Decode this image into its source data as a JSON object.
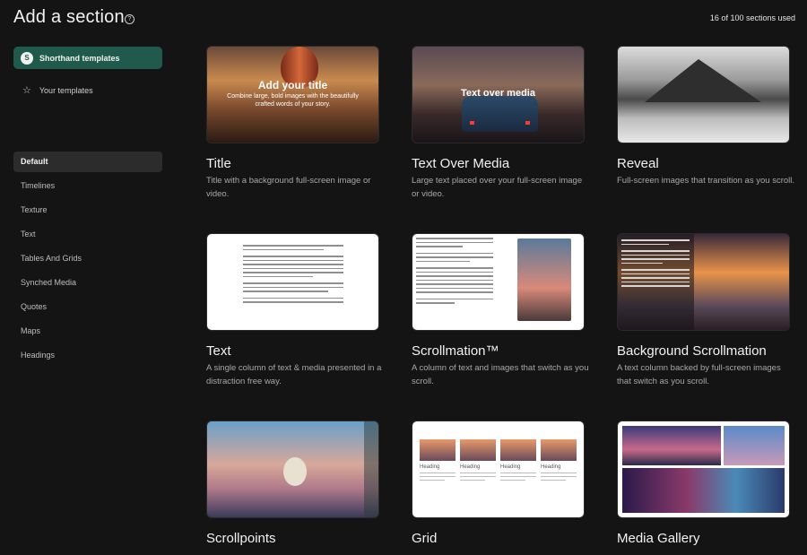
{
  "header": {
    "title": "Add a section",
    "help_icon": "?",
    "usage": "16 of 100 sections used"
  },
  "sidebar": {
    "template_tabs": [
      {
        "label": "Shorthand templates",
        "icon": "S"
      },
      {
        "label": "Your templates",
        "icon": "star-outline-icon"
      }
    ],
    "categories": [
      "Default",
      "Timelines",
      "Texture",
      "Text",
      "Tables And Grids",
      "Synched Media",
      "Quotes",
      "Maps",
      "Headings"
    ]
  },
  "cards": [
    {
      "title": "Title",
      "desc": "Title with a background full-screen image or video.",
      "thumb_title": "Add your title",
      "thumb_sub": "Combine large, bold images with the beautifully crafted words of your story."
    },
    {
      "title": "Text Over Media",
      "desc": "Large text placed over your full-screen image or video.",
      "thumb_title": "Text over media"
    },
    {
      "title": "Reveal",
      "desc": "Full-screen images that transition as you scroll."
    },
    {
      "title": "Text",
      "desc": "A single column of text & media presented in a distraction free way."
    },
    {
      "title": "Scrollmation™",
      "desc": "A column of text and images that switch as you scroll."
    },
    {
      "title": "Background Scrollmation",
      "desc": "A text column backed by full-screen images that switch as you scroll."
    },
    {
      "title": "Scrollpoints",
      "desc": ""
    },
    {
      "title": "Grid",
      "desc": "",
      "grid_heading": "Heading"
    },
    {
      "title": "Media Gallery",
      "desc": ""
    }
  ],
  "colors": {
    "accent": "#1f5a4d",
    "background": "#141414"
  }
}
